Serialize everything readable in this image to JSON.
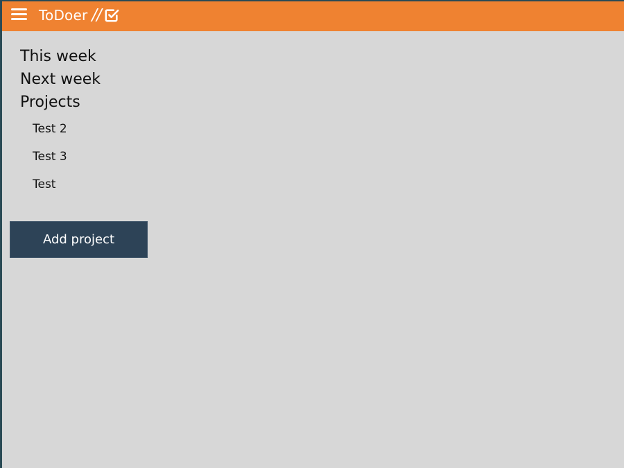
{
  "header": {
    "app_name": "ToDoer",
    "slashes": "//",
    "logo_icon": "checkbox-icon",
    "menu_icon": "hamburger-menu-icon",
    "accent_color": "#ef8231"
  },
  "nav": {
    "items": [
      {
        "label": "This week"
      },
      {
        "label": "Next week"
      },
      {
        "label": "Projects"
      }
    ]
  },
  "projects": {
    "items": [
      {
        "label": "Test 2"
      },
      {
        "label": "Test 3"
      },
      {
        "label": "Test"
      }
    ]
  },
  "actions": {
    "add_project_label": "Add project",
    "button_color": "#2d4357"
  },
  "content_background": "#d7d7d7"
}
